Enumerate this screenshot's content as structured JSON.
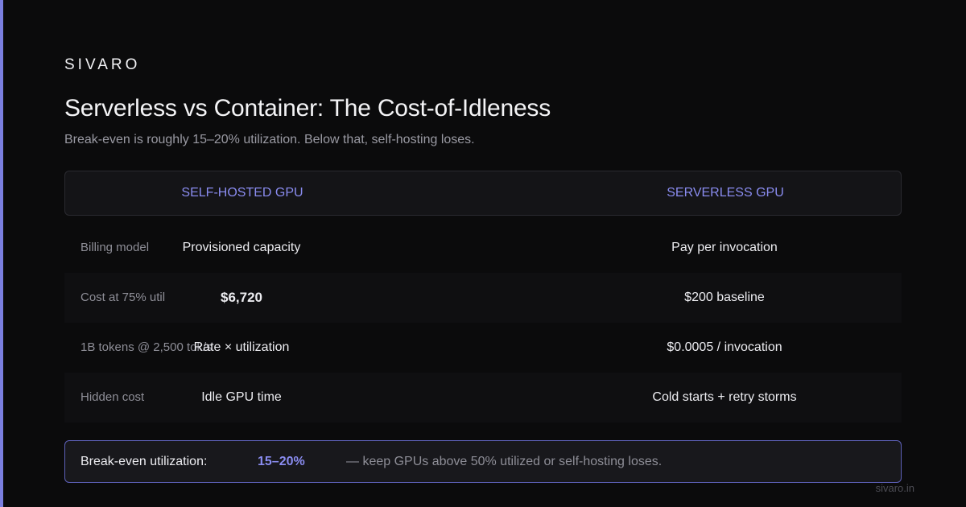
{
  "brand": "SIVARO",
  "title": "Serverless vs Container: The Cost-of-Idleness",
  "subtitle": "Break-even is roughly 15–20% utilization. Below that, self-hosting loses.",
  "columns": {
    "self_hosted": "SELF-HOSTED GPU",
    "serverless": "SERVERLESS GPU"
  },
  "rows": [
    {
      "label": "Billing model",
      "self_hosted": "Provisioned capacity",
      "serverless": "Pay per invocation"
    },
    {
      "label": "Cost at 75% util",
      "self_hosted": "$6,720",
      "serverless": "$200 baseline"
    },
    {
      "label": "1B tokens @ 2,500 tok/s",
      "self_hosted": "Rate × utilization",
      "serverless": "$0.0005 / invocation"
    },
    {
      "label": "Hidden cost",
      "self_hosted": "Idle GPU time",
      "serverless": "Cold starts + retry storms"
    }
  ],
  "callout": {
    "label": "Break-even utilization:",
    "value": "15–20%",
    "note": "— keep GPUs above 50% utilized or self-hosting loses."
  },
  "footer": "sivaro.in",
  "colors": {
    "accent": "#8a8cf0",
    "background": "#0b0b0c"
  }
}
